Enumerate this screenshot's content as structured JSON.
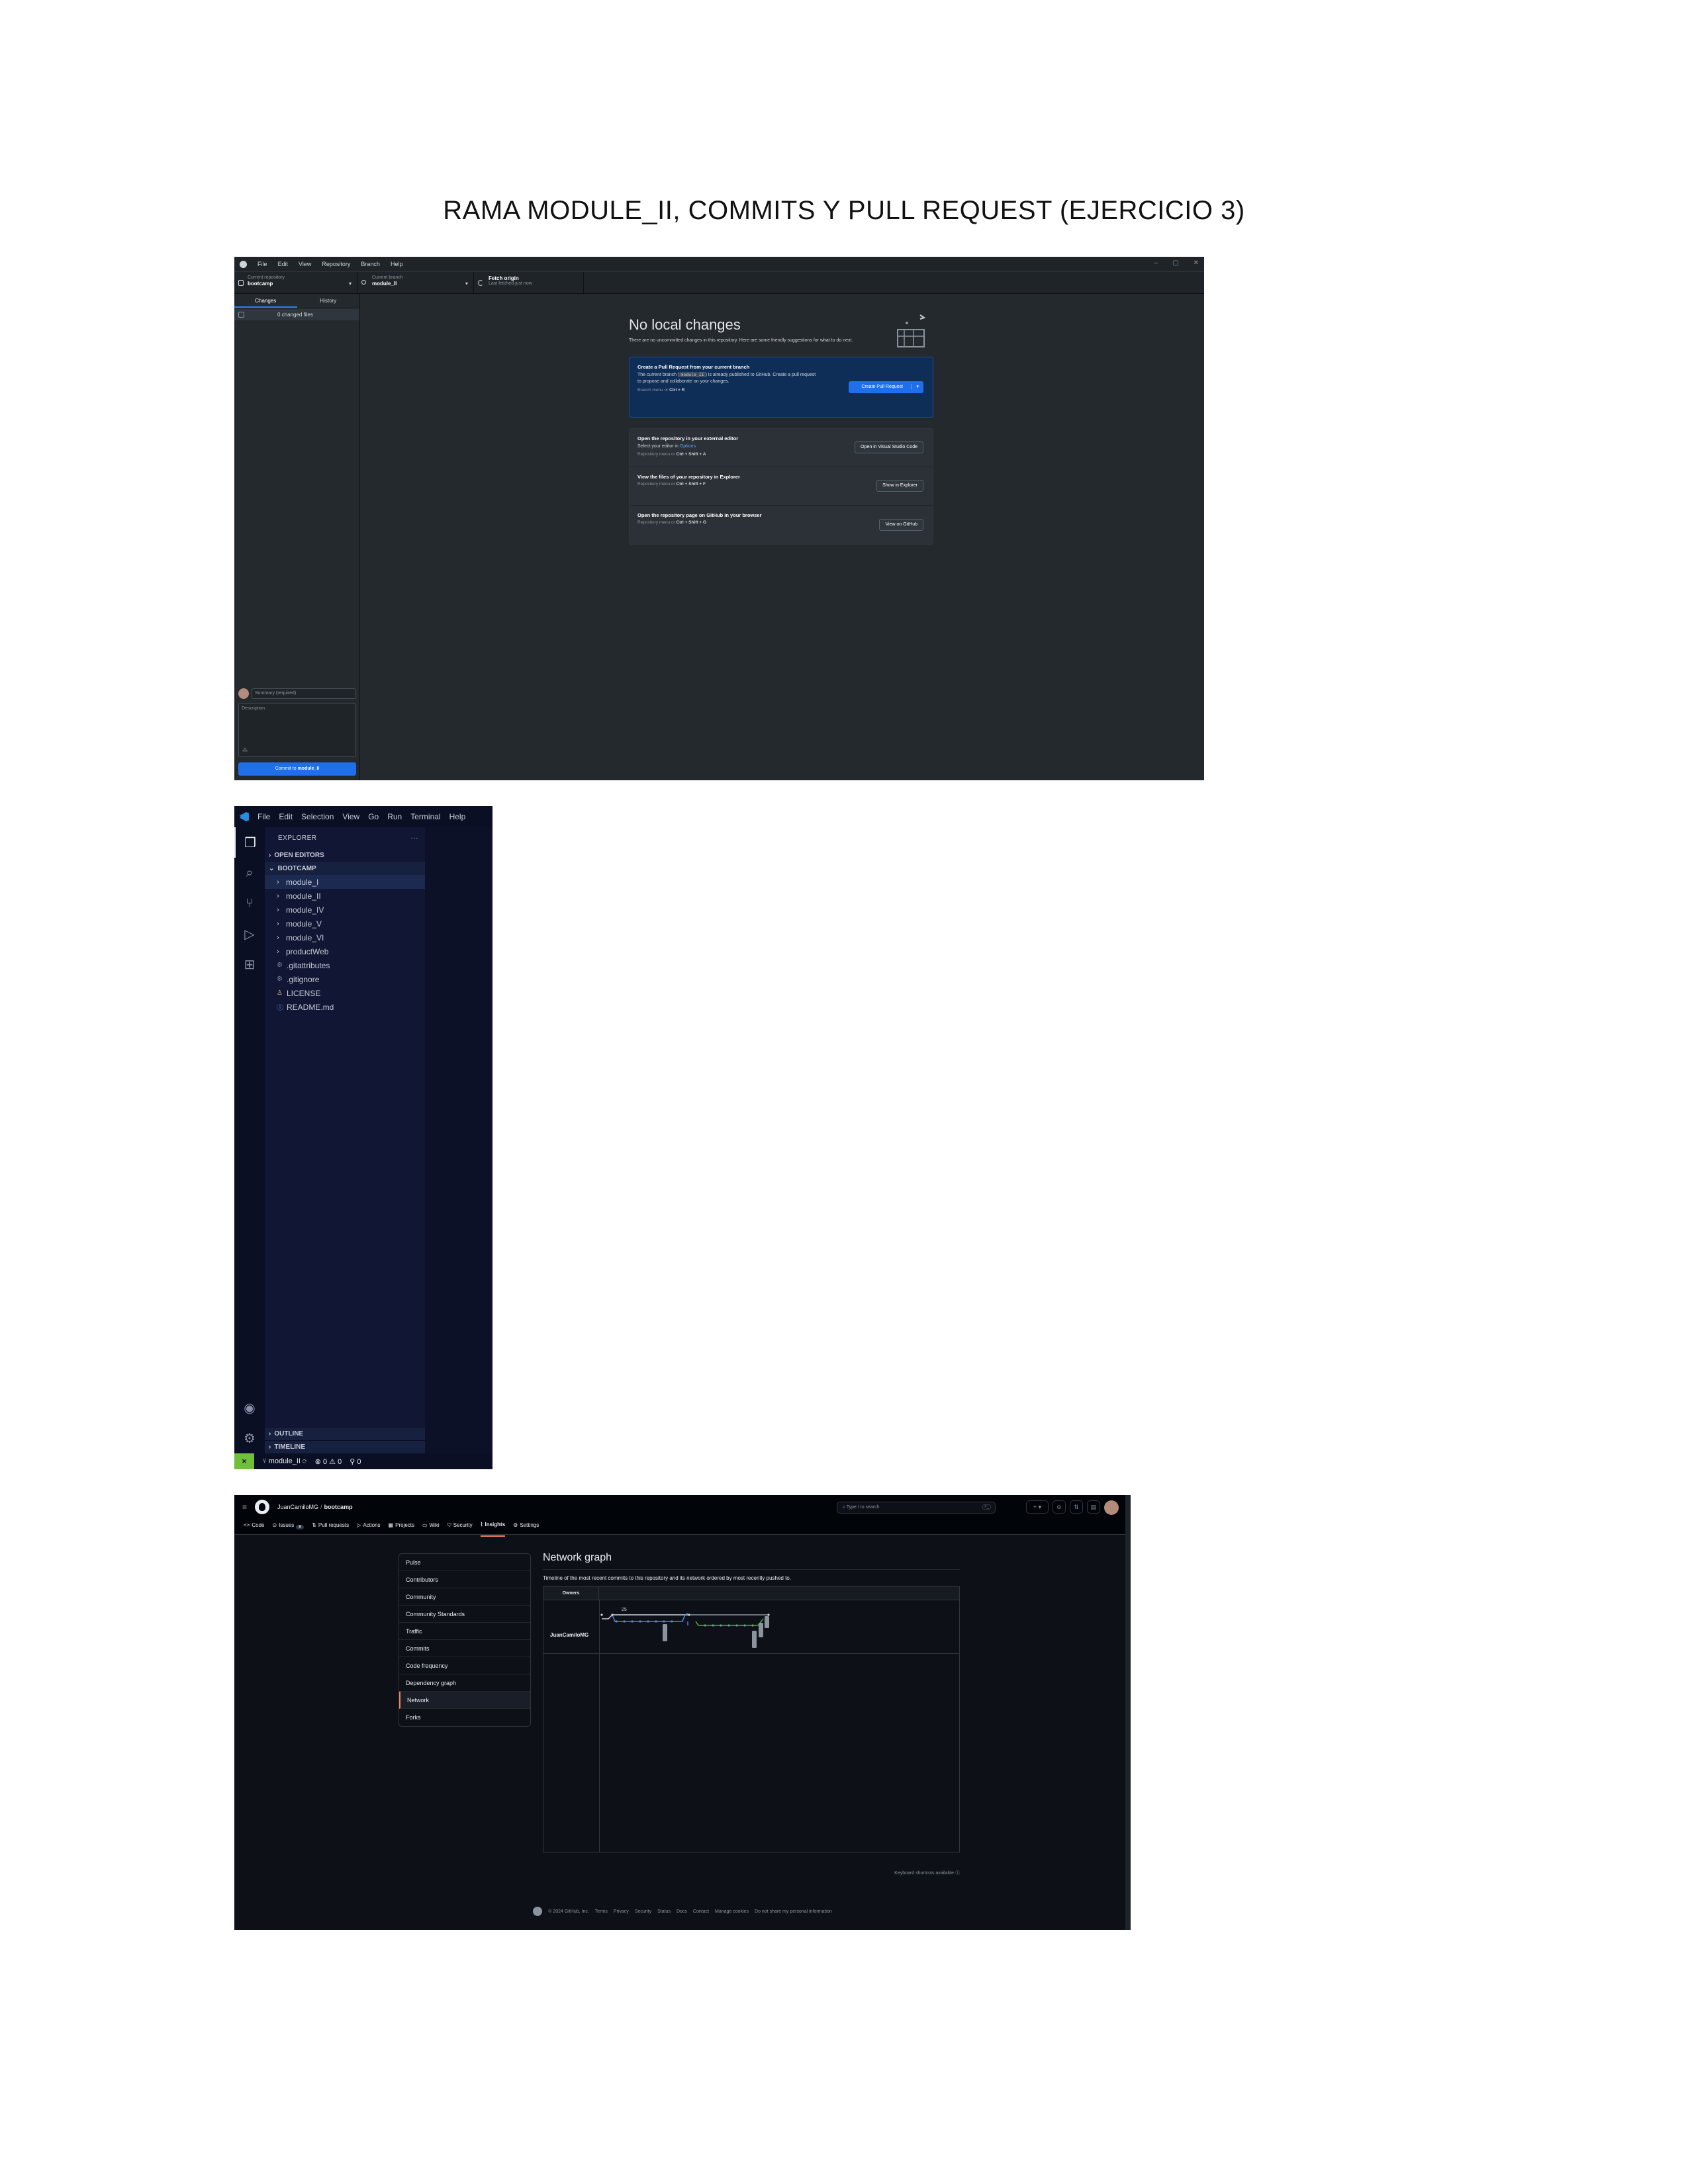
{
  "document": {
    "title": "RAMA MODULE_II, COMMITS Y PULL REQUEST (EJERCICIO 3)"
  },
  "github_desktop": {
    "menu": [
      "File",
      "Edit",
      "View",
      "Repository",
      "Branch",
      "Help"
    ],
    "window_controls": [
      "–",
      "▢",
      "✕"
    ],
    "toolbar": {
      "repo_label": "Current repository",
      "repo_value": "bootcamp",
      "branch_label": "Current branch",
      "branch_value": "module_II",
      "fetch_label": "Fetch origin",
      "fetch_sub": "Last fetched just now"
    },
    "tabs": {
      "changes": "Changes",
      "history": "History"
    },
    "changed_files": "0 changed files",
    "commit": {
      "summary_placeholder": "Summary (required)",
      "description_placeholder": "Description",
      "coauthor_icon": "person-add-icon",
      "button_prefix": "Commit to",
      "button_branch": "module_II"
    },
    "main": {
      "heading": "No local changes",
      "sub": "There are no uncommitted changes in this repository. Here are some friendly suggestions for what to do next.",
      "cards": {
        "pr_title": "Create a Pull Request from your current branch",
        "pr_desc_1": "The current branch (",
        "pr_desc_code": "module_II",
        "pr_desc_2": ") is already published to GitHub. Create a pull request to propose and collaborate on your changes.",
        "pr_key": "Branch menu or",
        "pr_shortcut": "Ctrl + R",
        "pr_button": "Create Pull Request",
        "editor_title": "Open the repository in your external editor",
        "editor_desc_1": "Select your editor in",
        "editor_desc_link": "Options",
        "editor_key": "Repository menu or",
        "editor_shortcut": "Ctrl + Shift + A",
        "editor_button": "Open in Visual Studio Code",
        "explorer_title": "View the files of your repository in Explorer",
        "explorer_key": "Repository menu or",
        "explorer_shortcut": "Ctrl + Shift + F",
        "explorer_button": "Show in Explorer",
        "github_title": "Open the repository page on GitHub in your browser",
        "github_key": "Repository menu or",
        "github_shortcut": "Ctrl + Shift + G",
        "github_button": "View on GitHub"
      }
    }
  },
  "vscode": {
    "menu": [
      "File",
      "Edit",
      "Selection",
      "View",
      "Go",
      "Run",
      "Terminal",
      "Help"
    ],
    "explorer_title": "EXPLORER",
    "explorer_more": "···",
    "sections": {
      "open_editors": "OPEN EDITORS",
      "bootcamp": "BOOTCAMP",
      "outline": "OUTLINE",
      "timeline": "TIMELINE"
    },
    "tree": {
      "folders": [
        "module_I",
        "module_II",
        "module_IV",
        "module_V",
        "module_VI",
        "productWeb"
      ],
      "files": [
        ".gitattributes",
        ".gitignore",
        "LICENSE",
        "README.md"
      ]
    },
    "status": {
      "branch": "module_II",
      "sync_icon": "sync-icon",
      "errors": "0",
      "warnings": "0",
      "ports": "0"
    }
  },
  "github_web": {
    "owner": "JuanCamiloMG",
    "repo": "bootcamp",
    "search_placeholder": "Type / to search",
    "tabs": [
      "Code",
      "Issues",
      "Pull requests",
      "Actions",
      "Projects",
      "Wiki",
      "Security",
      "Insights",
      "Settings"
    ],
    "issues_count": "8",
    "active_tab": "Insights",
    "insights_nav": [
      "Pulse",
      "Contributors",
      "Community",
      "Community Standards",
      "Traffic",
      "Commits",
      "Code frequency",
      "Dependency graph",
      "Network",
      "Forks"
    ],
    "active_nav": "Network",
    "heading": "Network graph",
    "description": "Timeline of the most recent commits to this repository and its network ordered by most recently pushed to.",
    "owners_header": "Owners",
    "date_label": "25",
    "graph_owner": "JuanCamiloMG",
    "keyboard_hint": "Keyboard shortcuts available",
    "footer": [
      "© 2024 GitHub, Inc.",
      "Terms",
      "Privacy",
      "Security",
      "Status",
      "Docs",
      "Contact",
      "Manage cookies",
      "Do not share my personal information"
    ],
    "colors": {
      "main_line": "#c9d1d9",
      "branch_blue": "#3b8eea",
      "branch_green": "#3fb950",
      "accent": "#f78166"
    }
  }
}
